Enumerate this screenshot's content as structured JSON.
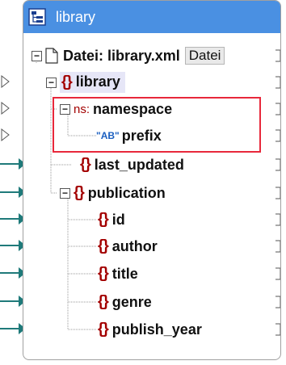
{
  "component": {
    "title": "library",
    "title_icon": "schema-component-icon"
  },
  "file_row": {
    "label": "Datei: library.xml",
    "button": "Datei"
  },
  "nodes": {
    "library": "library",
    "namespace_prefix": "ns:",
    "namespace": "namespace",
    "ab_badge": "\"AB\"",
    "prefix": "prefix",
    "last_updated": "last_updated",
    "publication": "publication",
    "id": "id",
    "author": "author",
    "title": "title",
    "genre": "genre",
    "publish_year": "publish_year"
  },
  "colors": {
    "titlebar": "#4a90e2",
    "element_brace": "#a30000",
    "attribute_badge": "#1b5fc0",
    "highlight_box": "#e8283b",
    "connector": "#1f7a7a"
  }
}
